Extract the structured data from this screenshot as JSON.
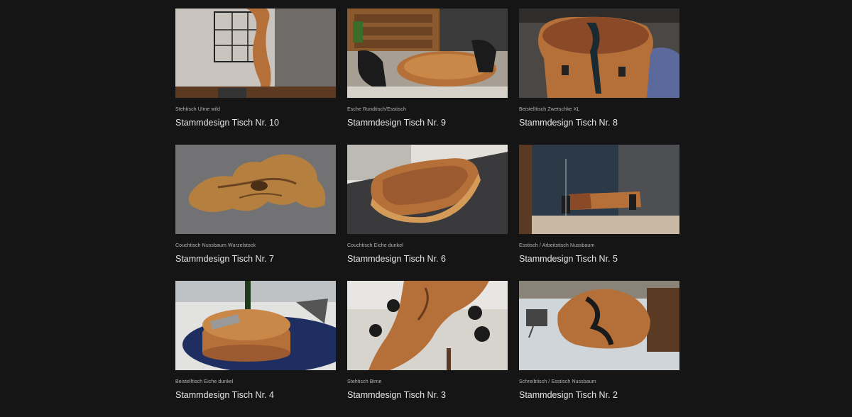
{
  "gallery": {
    "items": [
      {
        "subtitle": "Stehtisch Ulme wild",
        "title": "Stammdesign Tisch Nr. 10",
        "image": "standing-elm-table-photo"
      },
      {
        "subtitle": "Esche Rundtisch/Esstisch",
        "title": "Stammdesign Tisch Nr. 9",
        "image": "round-ash-dining-table-photo"
      },
      {
        "subtitle": "Beistelltisch Zwetschke XL",
        "title": "Stammdesign Tisch Nr. 8",
        "image": "plum-side-table-photo"
      },
      {
        "subtitle": "Couchtisch Nussbaum Wurzelstock",
        "title": "Stammdesign Tisch Nr. 7",
        "image": "walnut-root-coffee-table-photo"
      },
      {
        "subtitle": "Couchtisch Eiche dunkel",
        "title": "Stammdesign Tisch Nr. 6",
        "image": "dark-oak-coffee-table-photo"
      },
      {
        "subtitle": "Esstisch / Arbeitstisch Nussbaum",
        "title": "Stammdesign Tisch Nr. 5",
        "image": "walnut-dining-table-photo"
      },
      {
        "subtitle": "Beistelltisch Eiche dunkel",
        "title": "Stammdesign Tisch Nr. 4",
        "image": "dark-oak-side-table-photo"
      },
      {
        "subtitle": "Stehtisch Birne",
        "title": "Stammdesign Tisch Nr. 3",
        "image": "pear-standing-table-photo"
      },
      {
        "subtitle": "Schreibtisch / Esstisch Nussbaum",
        "title": "Stammdesign Tisch Nr. 2",
        "image": "walnut-desk-table-photo"
      }
    ]
  },
  "colors": {
    "background": "#151515",
    "wood": "#b5703a",
    "title_text": "#e6e6e6",
    "subtitle_text": "#b5b5b5"
  }
}
